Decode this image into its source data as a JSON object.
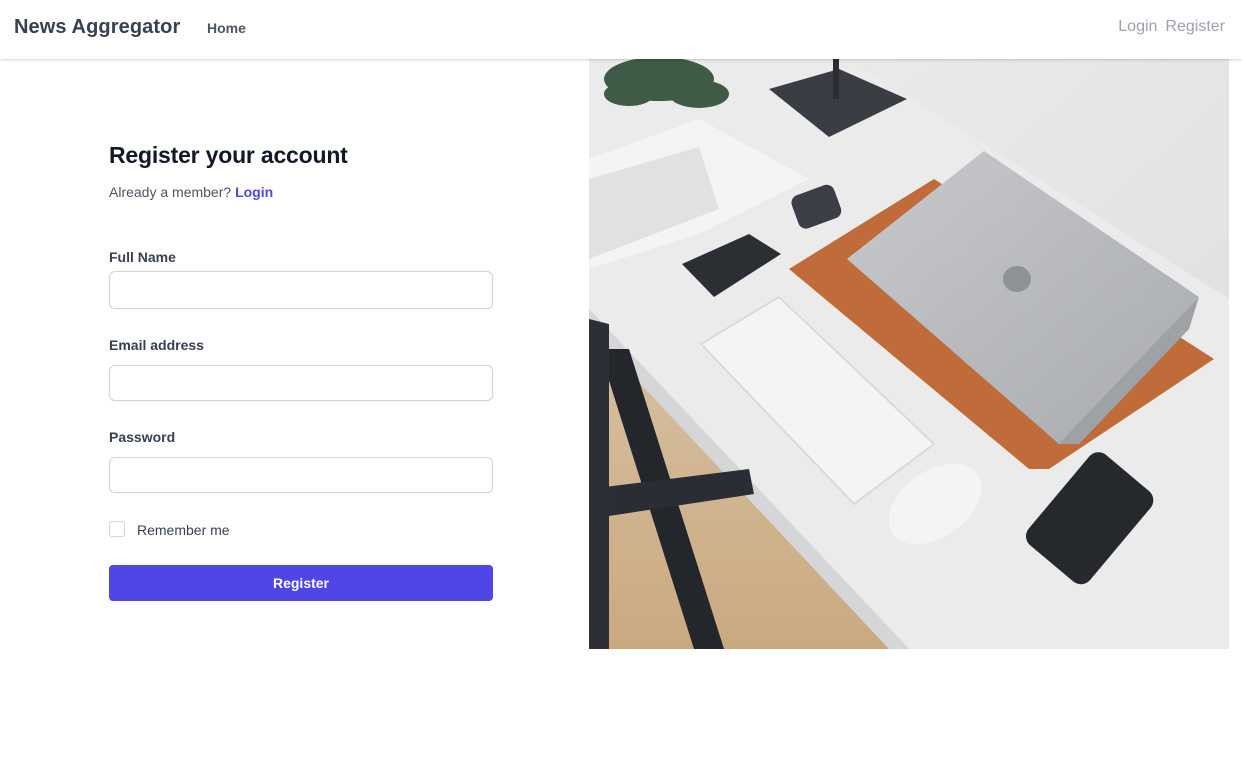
{
  "navbar": {
    "brand": "News Aggregator",
    "home": "Home",
    "login": "Login",
    "register": "Register"
  },
  "form": {
    "title": "Register your account",
    "subtitle_prefix": "Already a member?",
    "subtitle_link": "Login",
    "full_name_label": "Full Name",
    "full_name_value": "",
    "email_label": "Email address",
    "email_value": "",
    "password_label": "Password",
    "password_value": "",
    "remember_label": "Remember me",
    "remember_checked": false,
    "submit_label": "Register"
  },
  "colors": {
    "accent": "#4f46e5",
    "brand_text": "#374151",
    "nav_muted": "#9ca3af"
  },
  "icons": {
    "photo": "workspace-desk-photo"
  }
}
